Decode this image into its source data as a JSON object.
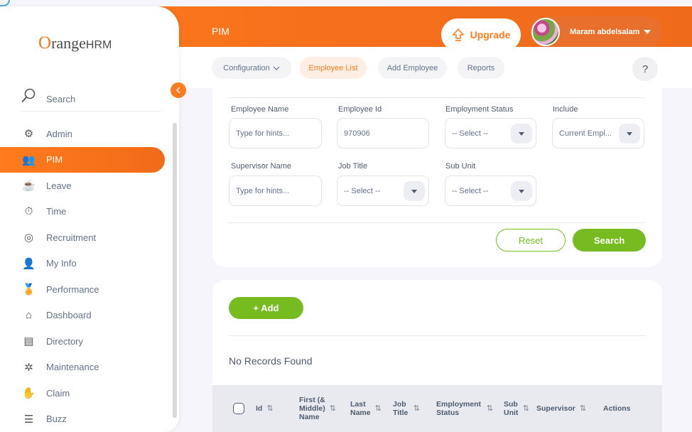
{
  "header": {
    "title": "PIM",
    "upgrade_label": "Upgrade",
    "user_name": "Maram abdelsalam"
  },
  "subnav": {
    "items": [
      "Configuration",
      "Employee List",
      "Add Employee",
      "Reports"
    ],
    "help": "?"
  },
  "sidebar": {
    "brand_o": "O",
    "brand_range": "range",
    "brand_hrm": "HRM",
    "search_label": "Search",
    "items": [
      "Admin",
      "PIM",
      "Leave",
      "Time",
      "Recruitment",
      "My Info",
      "Performance",
      "Dashboard",
      "Directory",
      "Maintenance",
      "Claim",
      "Buzz"
    ],
    "icons": [
      "admin-icon",
      "pim-icon",
      "leave-icon",
      "time-icon",
      "recruitment-icon",
      "my-info-icon",
      "performance-icon",
      "dashboard-icon",
      "directory-icon",
      "maintenance-icon",
      "claim-icon",
      "buzz-icon"
    ],
    "active": "PIM"
  },
  "filters": {
    "employee_name": {
      "label": "Employee Name",
      "placeholder": "Type for hints..."
    },
    "employee_id": {
      "label": "Employee Id",
      "value": "970906"
    },
    "employment_status": {
      "label": "Employment Status",
      "value": "-- Select --"
    },
    "include": {
      "label": "Include",
      "value": "Current Empl..."
    },
    "supervisor_name": {
      "label": "Supervisor Name",
      "placeholder": "Type for hints..."
    },
    "job_title": {
      "label": "Job Title",
      "value": "-- Select --"
    },
    "sub_unit": {
      "label": "Sub Unit",
      "value": "-- Select --"
    },
    "reset_label": "Reset",
    "search_label": "Search"
  },
  "results": {
    "add_label": "+ Add",
    "empty_text": "No Records Found",
    "columns": [
      "Id",
      "First (& Middle) Name",
      "Last Name",
      "Job Title",
      "Employment Status",
      "Sub Unit",
      "Supervisor",
      "Actions"
    ]
  },
  "colors": {
    "accent": "#ff7b1d",
    "success": "#76bc21"
  }
}
